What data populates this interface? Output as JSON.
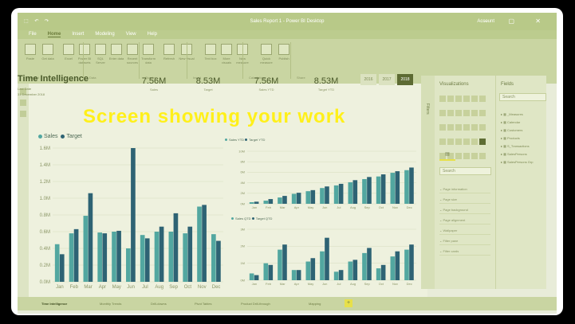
{
  "window": {
    "title": "Sales Report 1 - Power BI Desktop",
    "user": "Account",
    "quick_access": "⬚ ↶ ↷",
    "controls": "– ▢ ✕"
  },
  "menu": [
    "File",
    "Home",
    "Insert",
    "Modeling",
    "View",
    "Help"
  ],
  "menu_active": "Home",
  "ribbon": {
    "buttons": [
      "Paste",
      "Get data",
      "Excel",
      "Power BI datasets",
      "SQL Server",
      "Enter data",
      "Recent sources",
      "Transform data",
      "Refresh",
      "New visual",
      "Text box",
      "More visuals",
      "New measure",
      "Quick measure",
      "Publish"
    ],
    "groups": [
      "Clipboard",
      "Data",
      "Queries",
      "Insert",
      "Calculations",
      "Share"
    ]
  },
  "report": {
    "title": "Time Intelligence",
    "subtitle1": "Last Date",
    "subtitle2": "31 December 2018",
    "kpis": [
      {
        "value": "7.56M",
        "label": "Sales"
      },
      {
        "value": "8.53M",
        "label": "Target"
      },
      {
        "value": "7.56M",
        "label": "Sales YTD"
      },
      {
        "value": "8.53M",
        "label": "Target YTD"
      }
    ],
    "years": [
      "2016",
      "2017",
      "2018"
    ],
    "selected_year": "2018"
  },
  "overlay_text": "Screen showing  your work",
  "colors": {
    "sales": "#52a7a0",
    "target": "#2e6374",
    "accent": "#5d6b33",
    "overlay": "#fff01a"
  },
  "chart_data": [
    {
      "type": "bar",
      "categories": [
        "Jan",
        "Feb",
        "Mar",
        "Apr",
        "May",
        "Jun",
        "Jul",
        "Aug",
        "Sep",
        "Oct",
        "Nov",
        "Dec"
      ],
      "series": [
        {
          "name": "Sales",
          "values": [
            0.45,
            0.58,
            0.79,
            0.59,
            0.6,
            0.4,
            0.56,
            0.6,
            0.6,
            0.58,
            0.9,
            0.57
          ]
        },
        {
          "name": "Target",
          "values": [
            0.33,
            0.63,
            1.06,
            0.58,
            0.61,
            1.6,
            0.52,
            0.66,
            0.82,
            0.66,
            0.92,
            0.49
          ]
        }
      ],
      "yticks": [
        "0.0M",
        "0.2M",
        "0.4M",
        "0.6M",
        "0.8M",
        "1.0M",
        "1.2M",
        "1.4M",
        "1.6M"
      ],
      "ylim": [
        0,
        1.6
      ]
    },
    {
      "type": "bar",
      "categories": [
        "Jan",
        "Feb",
        "Mar",
        "Apr",
        "May",
        "Jun",
        "Jul",
        "Aug",
        "Sep",
        "Oct",
        "Nov",
        "Dec"
      ],
      "series": [
        {
          "name": "Sales YTD",
          "values": [
            0.3,
            0.6,
            1.2,
            1.9,
            2.4,
            3.0,
            3.5,
            4.1,
            4.7,
            5.2,
            5.9,
            6.4
          ]
        },
        {
          "name": "Target YTD",
          "values": [
            0.4,
            0.9,
            1.5,
            2.1,
            2.6,
            3.3,
            3.8,
            4.5,
            5.1,
            5.6,
            6.2,
            6.9
          ]
        }
      ],
      "yticks": [
        "0M",
        "2M",
        "4M",
        "6M",
        "8M",
        "10M"
      ],
      "ylim": [
        0,
        10
      ]
    },
    {
      "type": "bar",
      "categories": [
        "Jan",
        "Feb",
        "Mar",
        "Apr",
        "May",
        "Jun",
        "Jul",
        "Aug",
        "Sep",
        "Oct",
        "Nov",
        "Dec"
      ],
      "series": [
        {
          "name": "Sales QTD",
          "values": [
            0.4,
            1.0,
            1.8,
            0.6,
            1.1,
            1.7,
            0.5,
            1.1,
            1.6,
            0.7,
            1.4,
            1.8
          ]
        },
        {
          "name": "Target QTD",
          "values": [
            0.3,
            0.9,
            2.1,
            0.6,
            1.3,
            2.5,
            0.6,
            1.2,
            1.9,
            0.9,
            1.7,
            2.1
          ]
        }
      ],
      "yticks": [
        "0M",
        "1M",
        "2M",
        "3M"
      ],
      "ylim": [
        0,
        3
      ]
    }
  ],
  "filters_label": "Filters",
  "visualizations": {
    "title": "Visualizations",
    "search_placeholder": "Search",
    "sections": [
      "Page information",
      "Page size",
      "Page background",
      "Page alignment",
      "Wallpaper",
      "Filter pane",
      "Filter cards"
    ]
  },
  "fields": {
    "title": "Fields",
    "search_placeholder": "Search",
    "tables": [
      "_Measures",
      "Calendar",
      "Customers",
      "Products",
      "S_Transactions",
      "SalesPersons",
      "SalesPersons Grp"
    ]
  },
  "tabs": [
    "Time Intelligence",
    "Monthly Trends",
    "Drill-downs",
    "Pivot Tables",
    "Product Drill-through",
    "Mapping"
  ],
  "active_tab": "Time Intelligence"
}
